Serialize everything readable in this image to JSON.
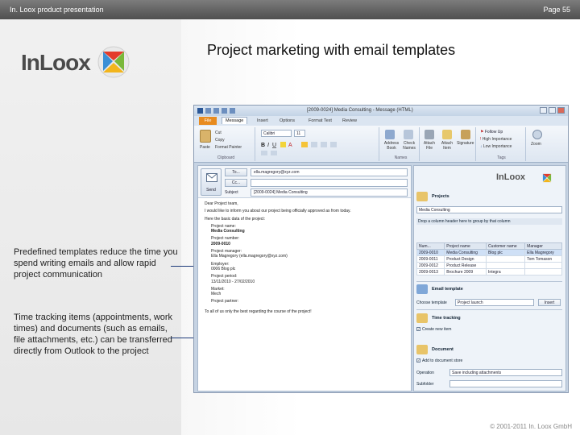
{
  "header": {
    "left": "In. Loox product presentation",
    "right": "Page 55"
  },
  "slide": {
    "logo_text": "InLoox",
    "title": "Project marketing with email templates",
    "note1": "Predefined templates reduce the time you spend writing emails and allow rapid project communication",
    "note2": "Time tracking items (appointments, work times) and documents (such as emails, file attachments, etc.) can be transferred directly from Outlook to the project",
    "footer": "© 2001-2011 In. Loox GmbH"
  },
  "window": {
    "title": "[2009-0024] Media Consulting - Message (HTML)",
    "file_tab": "File",
    "tabs": [
      "Message",
      "Insert",
      "Options",
      "Format Text",
      "Review"
    ],
    "ribbon": {
      "paste": "Paste",
      "cut": "Cut",
      "copy": "Copy",
      "format_painter": "Format Painter",
      "clipboard": "Clipboard",
      "font": "Calibri",
      "size": "11",
      "address_book": "Address Book",
      "check_names": "Check Names",
      "names": "Names",
      "attach_file": "Attach File",
      "attach_item": "Attach Item",
      "signature": "Signature",
      "follow_up": "Follow Up",
      "high_importance": "High Importance",
      "low_importance": "Low Importance",
      "tags": "Tags",
      "zoom": "Zoom"
    },
    "compose": {
      "send": "Send",
      "to_label": "To...",
      "to_value": "ella.magregory@xyz.com",
      "cc_label": "Cc...",
      "subject_label": "Subject",
      "subject_value": "[2009-0024] Media Consulting",
      "body": [
        "Dear Project team,",
        "I would like to inform you about our project being officially approved as from today.",
        "Here the basic data of the project:",
        "Project name:",
        "Media Consulting",
        "Project number:",
        "2009-0010",
        "Project manager:",
        "Ella Magregory (ella.magregory@xyz.com)",
        "Employer:",
        "0006 Blog plc",
        "Project period:",
        "13/11/2010 - 27/02/2010",
        "Market:",
        "Mech",
        "Project partner:",
        "To all of us only the best regarding the course of the project!"
      ]
    },
    "panel": {
      "logo": "InLoox",
      "projects_title": "Projects",
      "projects_select": "Media Consulting",
      "group_hint": "Drop a column header here to group by that column",
      "columns": [
        "Num...",
        "Project name",
        "Customer name",
        "Manager"
      ],
      "rows": [
        [
          "2009-0010",
          "Media Consulting",
          "Blog plc",
          "Ella Magregory"
        ],
        [
          "2009-0011",
          "Product Design",
          "",
          "Tom Tomason"
        ],
        [
          "2009-0012",
          "Product Release",
          "",
          ""
        ],
        [
          "2009-0013",
          "Brochure 2009",
          "Integra",
          ""
        ]
      ],
      "email_template": "Email template",
      "choose_template": "Choose template",
      "template_value": "Project launch",
      "insert": "Insert",
      "time_tracking": "Time tracking",
      "create_new_item": "Create new item",
      "document": "Document",
      "add_to_doc": "Add to document store",
      "operation": "Operation",
      "operation_value": "Save including attachments",
      "subfolder": "Subfolder"
    }
  }
}
